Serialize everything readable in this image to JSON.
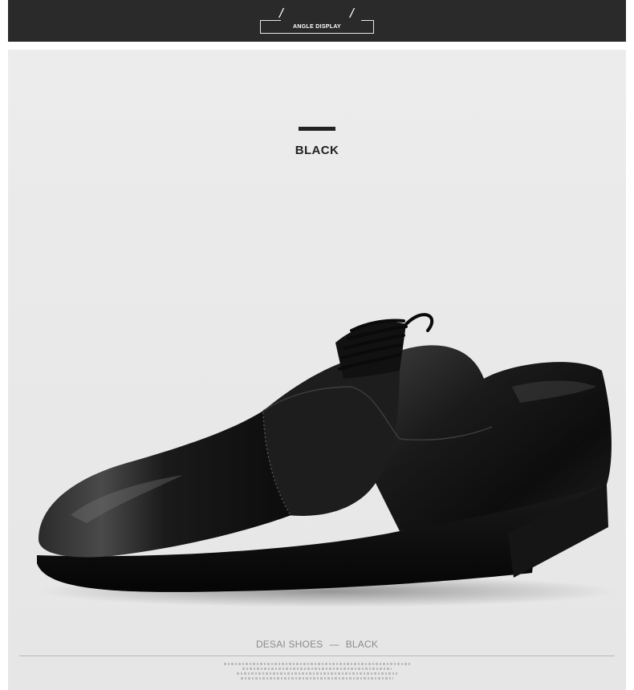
{
  "header": {
    "title": "ANGLE DISPLAY"
  },
  "product": {
    "color_title": "BLACK",
    "caption_brand": "DESAI SHOES",
    "caption_dash": "—",
    "caption_color": "BLACK",
    "image_alt_name": "black-cap-toe-oxford-shoe"
  },
  "colors": {
    "banner_bg": "#2a2a2a",
    "panel_bg": "#e9e9e9",
    "accent": "#222222",
    "caption_text": "#8a8a8a"
  }
}
